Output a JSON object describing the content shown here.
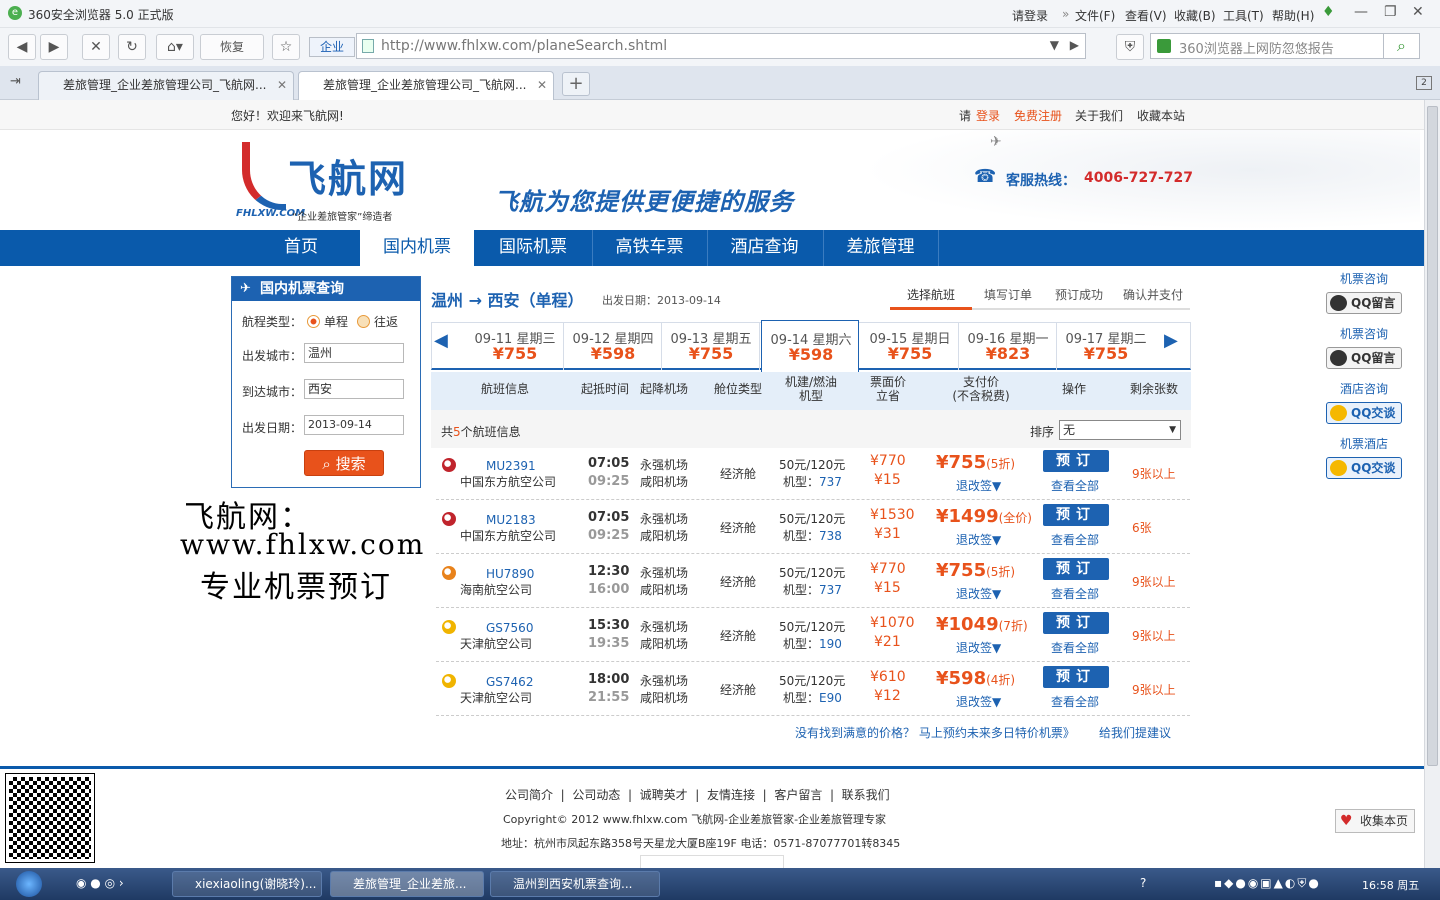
{
  "browser": {
    "title": "360安全浏览器 5.0 正式版",
    "menu": [
      "请登录",
      "文件(F)",
      "查看(V)",
      "收藏(B)",
      "工具(T)",
      "帮助(H)"
    ],
    "nav_restore": "恢复",
    "site_badge": "企业",
    "url": "http://www.fhlxw.com/planeSearch.shtml",
    "search_placeholder": "360浏览器上网防忽悠报告",
    "tabs": [
      "差旅管理_企业差旅管理公司_飞航网...",
      "差旅管理_企业差旅管理公司_飞航网..."
    ],
    "tab_count": "2"
  },
  "site": {
    "welcome": "您好！欢迎来飞航网!",
    "top_links": {
      "please": "请",
      "login": "登录",
      "register": "免费注册",
      "about": "关于我们",
      "favorite": "收藏本站"
    },
    "logo_name": "飞航网",
    "logo_domain": "FHLXW.COM",
    "logo_slogan": "“企业差旅管家”缔造者",
    "banner_slogan": "飞航为您提供更便捷的服务",
    "hotline_label": "客服热线：",
    "hotline": "4006-727-727",
    "nav": [
      "首页",
      "国内机票",
      "国际机票",
      "高铁车票",
      "酒店查询",
      "差旅管理"
    ]
  },
  "query": {
    "title": "国内机票查询",
    "trip_label": "航程类型：",
    "oneway": "单程",
    "roundtrip": "往返",
    "from_label": "出发城市：",
    "from": "温州",
    "to_label": "到达城市：",
    "to": "西安",
    "date_label": "出发日期：",
    "date": "2013-09-14",
    "search_btn": "搜索"
  },
  "promo": {
    "line1": "飞航网：",
    "line2": "www.fhlxw.com",
    "line3": "专业机票预订"
  },
  "results": {
    "route": "温州 → 西安（单程）",
    "depart": "出发日期：2013-09-14",
    "steps": [
      "选择航班",
      "填写订单",
      "预订成功",
      "确认并支付"
    ],
    "dates": [
      {
        "d": "09-11 星期三",
        "p": "¥755"
      },
      {
        "d": "09-12 星期四",
        "p": "¥598"
      },
      {
        "d": "09-13 星期五",
        "p": "¥755"
      },
      {
        "d": "09-14 星期六",
        "p": "¥598"
      },
      {
        "d": "09-15 星期日",
        "p": "¥755"
      },
      {
        "d": "09-16 星期一",
        "p": "¥823"
      },
      {
        "d": "09-17 星期二",
        "p": "¥755"
      }
    ],
    "headers": {
      "info": "航班信息",
      "times": "起抵时间",
      "airports": "起降机场",
      "cabin": "舱位类型",
      "fee1": "机建/燃油",
      "fee2": "机型",
      "face1": "票面价",
      "face2": "立省",
      "pay1": "支付价",
      "pay2": "(不含税费)",
      "op": "操作",
      "remain": "剩余张数"
    },
    "count_pre": "共",
    "count": "5",
    "count_post": "个航班信息",
    "sort_label": "排序",
    "sort_value": "无",
    "flights": [
      {
        "no": "MU2391",
        "air": "中国东方航空公司",
        "dep": "07:05",
        "arr": "09:25",
        "a1": "永强机场",
        "a2": "咸阳机场",
        "cabin": "经济舱",
        "fee": "50元/120元",
        "type_lbl": "机型：",
        "type": "737",
        "face": "¥770",
        "save": "¥15",
        "pay": "¥755",
        "disc": "(5折)",
        "change": "退改签",
        "book": "预订",
        "all": "查看全部",
        "remain": "9张以上",
        "color": "#c0242c"
      },
      {
        "no": "MU2183",
        "air": "中国东方航空公司",
        "dep": "07:05",
        "arr": "09:25",
        "a1": "永强机场",
        "a2": "咸阳机场",
        "cabin": "经济舱",
        "fee": "50元/120元",
        "type_lbl": "机型：",
        "type": "738",
        "face": "¥1530",
        "save": "¥31",
        "pay": "¥1499",
        "disc": "(全价)",
        "change": "退改签",
        "book": "预订",
        "all": "查看全部",
        "remain": "6张",
        "color": "#c0242c"
      },
      {
        "no": "HU7890",
        "air": "海南航空公司",
        "dep": "12:30",
        "arr": "16:00",
        "a1": "永强机场",
        "a2": "咸阳机场",
        "cabin": "经济舱",
        "fee": "50元/120元",
        "type_lbl": "机型：",
        "type": "737",
        "face": "¥770",
        "save": "¥15",
        "pay": "¥755",
        "disc": "(5折)",
        "change": "退改签",
        "book": "预订",
        "all": "查看全部",
        "remain": "9张以上",
        "color": "#e8821b"
      },
      {
        "no": "GS7560",
        "air": "天津航空公司",
        "dep": "15:30",
        "arr": "19:35",
        "a1": "永强机场",
        "a2": "咸阳机场",
        "cabin": "经济舱",
        "fee": "50元/120元",
        "type_lbl": "机型：",
        "type": "190",
        "face": "¥1070",
        "save": "¥21",
        "pay": "¥1049",
        "disc": "(7折)",
        "change": "退改签",
        "book": "预订",
        "all": "查看全部",
        "remain": "9张以上",
        "color": "#f0b400"
      },
      {
        "no": "GS7462",
        "air": "天津航空公司",
        "dep": "18:00",
        "arr": "21:55",
        "a1": "永强机场",
        "a2": "咸阳机场",
        "cabin": "经济舱",
        "fee": "50元/120元",
        "type_lbl": "机型：",
        "type": "E90",
        "face": "¥610",
        "save": "¥12",
        "pay": "¥598",
        "disc": "(4折)",
        "change": "退改签",
        "book": "预订",
        "all": "查看全部",
        "remain": "9张以上",
        "color": "#f0b400"
      }
    ],
    "bottom_link1": "没有找到满意的价格？ 马上预约未来多日特价机票》",
    "bottom_link2": "给我们提建议"
  },
  "side": [
    {
      "title": "机票咨询",
      "btn": "QQ留言",
      "style": "gray"
    },
    {
      "title": "机票咨询",
      "btn": "QQ留言",
      "style": "gray"
    },
    {
      "title": "酒店咨询",
      "btn": "QQ交谈",
      "style": "yellow"
    },
    {
      "title": "机票酒店",
      "btn": "QQ交谈",
      "style": "yellow"
    }
  ],
  "footer": {
    "links": [
      "公司简介",
      "公司动态",
      "诚聘英才",
      "友情连接",
      "客户留言",
      "联系我们"
    ],
    "copy": "Copyright© 2012 www.fhlxw.com 飞航网-企业差旅管家-企业差旅管理专家",
    "address": "地址：杭州市凤起东路358号天星龙大厦B座19F 电话：0571-87077701转8345",
    "favorite": "收集本页"
  },
  "taskbar": {
    "tasks": [
      "xiexiaoling(谢晓玲)...",
      "差旅管理_企业差旅...",
      "温州到西安机票查询..."
    ],
    "clock": "16:58 周五"
  }
}
